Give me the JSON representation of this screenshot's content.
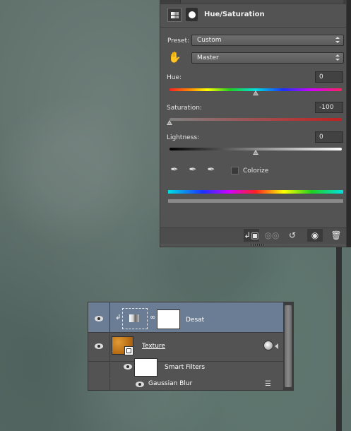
{
  "panel": {
    "title": "Hue/Saturation",
    "preset_label": "Preset:",
    "preset_value": "Custom",
    "channel_value": "Master",
    "hue_label": "Hue:",
    "hue_value": "0",
    "hue_position": 0.5,
    "saturation_label": "Saturation:",
    "saturation_value": "-100",
    "saturation_position": 0.0,
    "lightness_label": "Lightness:",
    "lightness_value": "0",
    "lightness_position": 0.5,
    "colorize_label": "Colorize",
    "colorize_checked": false,
    "icons": {
      "adjustment": "hue-saturation-icon",
      "mask": "mask-icon",
      "targeted_adjustment": "hand-icon",
      "eyedropper": "eyedropper-icon",
      "eyedropper_plus": "eyedropper-plus-icon",
      "eyedropper_minus": "eyedropper-minus-icon"
    },
    "footer": {
      "clip": "clip-to-layer-icon",
      "view_previous": "view-previous-icon",
      "reset": "reset-icon",
      "visibility": "eye-icon",
      "delete": "trash-icon"
    }
  },
  "layers": [
    {
      "name": "Desat",
      "selected": true,
      "clipped": true
    },
    {
      "name": "Texture",
      "selected": false,
      "smart_object": true
    },
    {
      "name": "Smart Filters",
      "sub": true
    },
    {
      "name": "Gaussian Blur",
      "filter": true
    }
  ],
  "colors": {
    "panel_bg": "#535353",
    "selected_row": "#6b7d95",
    "canvas": "#5b6c67",
    "texture_thumb": "#c07a1c"
  }
}
